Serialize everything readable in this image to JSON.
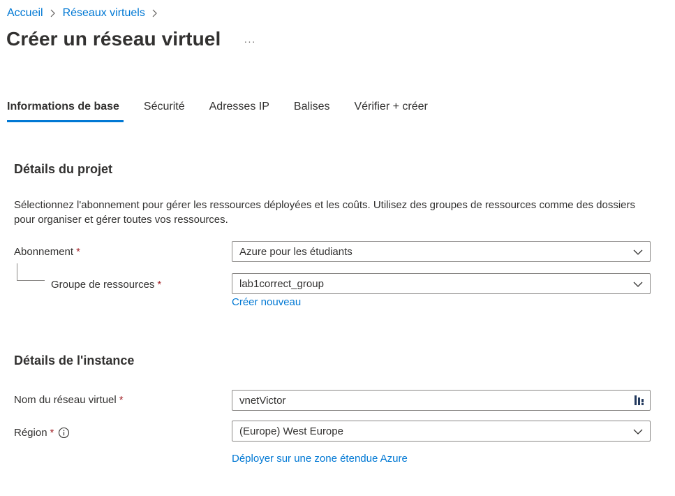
{
  "breadcrumb": {
    "items": [
      {
        "label": "Accueil"
      },
      {
        "label": "Réseaux virtuels"
      }
    ]
  },
  "page": {
    "title": "Créer un réseau virtuel",
    "more_label": "···"
  },
  "tabs": [
    {
      "label": "Informations de base",
      "active": true
    },
    {
      "label": "Sécurité",
      "active": false
    },
    {
      "label": "Adresses IP",
      "active": false
    },
    {
      "label": "Balises",
      "active": false
    },
    {
      "label": "Vérifier + créer",
      "active": false
    }
  ],
  "project": {
    "title": "Détails du projet",
    "description": "Sélectionnez l'abonnement pour gérer les ressources déployées et les coûts. Utilisez des groupes de ressources comme des dossiers pour organiser et gérer toutes vos ressources.",
    "subscription": {
      "label": "Abonnement",
      "required_mark": "*",
      "value": "Azure pour les étudiants"
    },
    "resource_group": {
      "label": "Groupe de ressources",
      "required_mark": "*",
      "value": "lab1correct_group",
      "create_new_label": "Créer nouveau"
    }
  },
  "instance": {
    "title": "Détails de l'instance",
    "vnet_name": {
      "label": "Nom du réseau virtuel",
      "required_mark": "*",
      "value": "vnetVictor"
    },
    "region": {
      "label": "Région",
      "required_mark": "*",
      "value": "(Europe) West Europe",
      "extended_zone_link": "Déployer sur une zone étendue Azure"
    }
  },
  "colors": {
    "accent": "#0078d4",
    "required": "#a4262c",
    "text": "#323130",
    "border": "#8a8886"
  }
}
